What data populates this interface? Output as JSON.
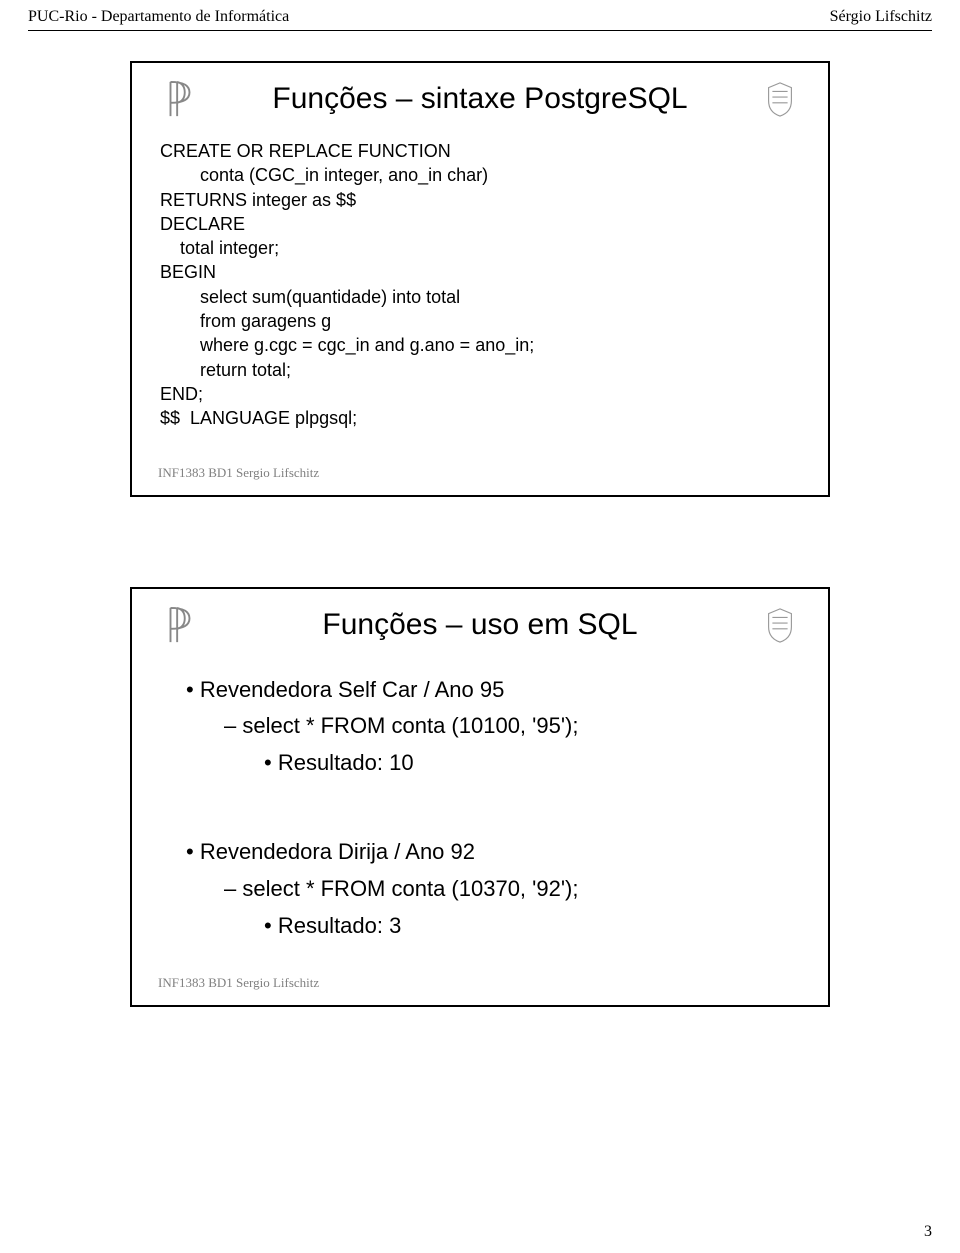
{
  "header": {
    "left": "PUC-Rio - Departamento de Informática",
    "right": "Sérgio Lifschitz"
  },
  "slide1": {
    "title": "Funções – sintaxe PostgreSQL",
    "code": "CREATE OR REPLACE FUNCTION\n        conta (CGC_in integer, ano_in char)\nRETURNS integer as $$\nDECLARE\n    total integer;\nBEGIN\n        select sum(quantidade) into total\n        from garagens g\n        where g.cgc = cgc_in and g.ano = ano_in;\n        return total;\nEND;\n$$  LANGUAGE plpgsql;",
    "footer": "INF1383 BD1 Sergio Lifschitz"
  },
  "slide2": {
    "title": "Funções – uso em SQL",
    "items": [
      {
        "b1": "Revendedora Self Car / Ano 95",
        "b2": "select * FROM conta (10100, '95');",
        "b3": "Resultado: 10"
      },
      {
        "b1": "Revendedora Dirija / Ano 92",
        "b2": "select * FROM conta (10370, '92');",
        "b3": "Resultado: 3"
      }
    ],
    "footer": "INF1383 BD1 Sergio Lifschitz"
  },
  "page_number": "3",
  "icons": {
    "left": "letter-p-icon",
    "right": "crest-icon"
  }
}
